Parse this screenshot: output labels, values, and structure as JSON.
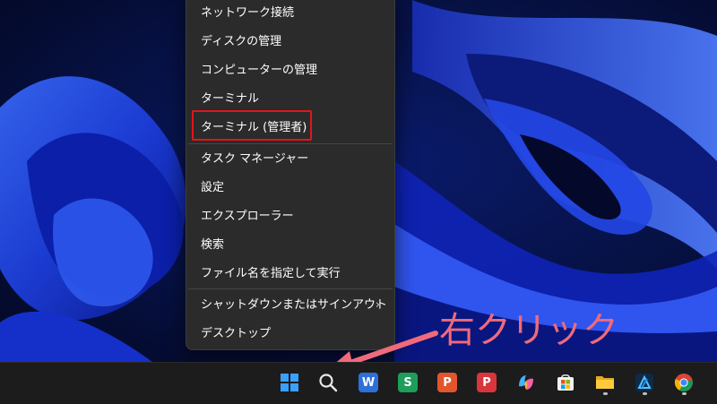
{
  "context_menu": {
    "items": [
      {
        "label": "ネットワーク接続"
      },
      {
        "label": "ディスクの管理"
      },
      {
        "label": "コンピューターの管理"
      },
      {
        "label": "ターミナル"
      },
      {
        "label": "ターミナル (管理者)",
        "highlighted": true
      },
      {
        "label": "タスク マネージャー"
      },
      {
        "label": "設定"
      },
      {
        "label": "エクスプローラー"
      },
      {
        "label": "検索"
      },
      {
        "label": "ファイル名を指定して実行"
      },
      {
        "label": "シャットダウンまたはサインアウト",
        "has_submenu": true,
        "submenu_icon": "chevron-right-icon"
      },
      {
        "label": "デスクトップ"
      }
    ],
    "highlight_color": "#e0161b"
  },
  "annotation": {
    "text": "右クリック",
    "color": "#f06a7a"
  },
  "taskbar": {
    "icons": [
      {
        "name": "start-icon"
      },
      {
        "name": "search-icon"
      },
      {
        "name": "wps-writer-icon",
        "letter": "W",
        "color": "#2f6fd8"
      },
      {
        "name": "wps-spreadsheets-icon",
        "letter": "S",
        "color": "#1f9d5a"
      },
      {
        "name": "wps-presentation-icon",
        "letter": "P",
        "color": "#e2552d"
      },
      {
        "name": "wps-pdf-icon",
        "letter": "P",
        "color": "#d9353c"
      },
      {
        "name": "copilot-icon"
      },
      {
        "name": "microsoft-store-icon"
      },
      {
        "name": "file-explorer-icon"
      },
      {
        "name": "affinity-icon"
      },
      {
        "name": "chrome-icon"
      }
    ]
  }
}
